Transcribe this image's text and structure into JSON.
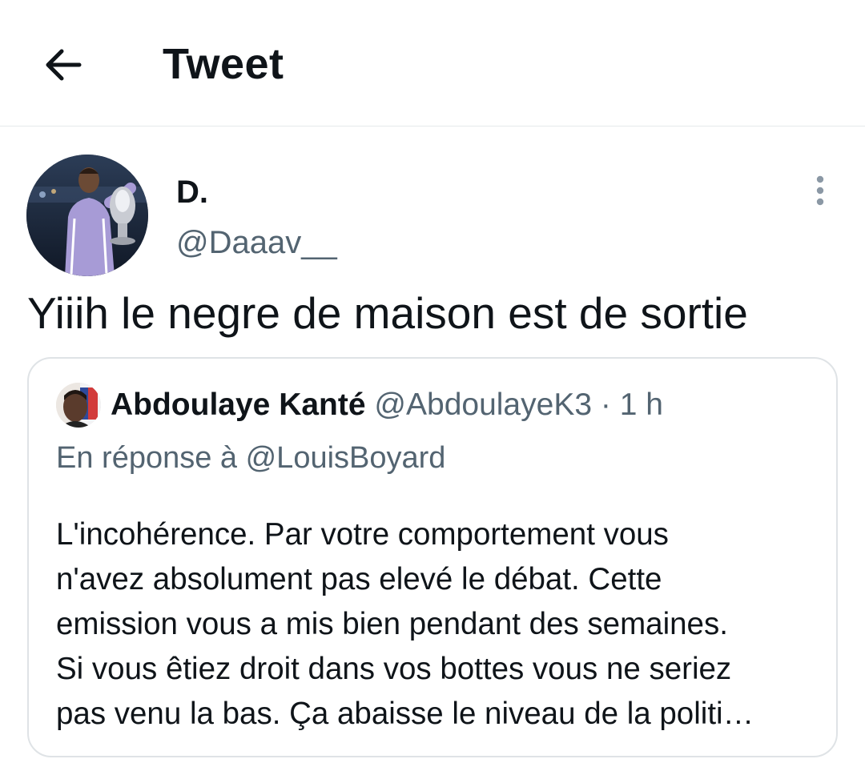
{
  "header": {
    "title": "Tweet",
    "back_icon": "arrow-left-icon"
  },
  "tweet": {
    "author": {
      "display_name": "D.",
      "handle": "@Daaav__"
    },
    "text": "Yiiih le negre de maison est de sortie",
    "more_icon": "vertical-ellipsis-icon"
  },
  "quoted_tweet": {
    "author": {
      "display_name": "Abdoulaye Kanté",
      "handle": "@AbdoulayeK3"
    },
    "separator": "·",
    "time": "1 h",
    "reply_context": "En réponse à @LouisBoyard",
    "lines": [
      "L'incohérence. Par votre comportement vous",
      "n'avez absolument pas elevé le débat. Cette",
      "emission vous a mis bien pendant des semaines.",
      "Si vous êtiez droit dans vos bottes vous ne seriez",
      "pas venu la bas. Ça abaisse le niveau de la politi…"
    ]
  },
  "colors": {
    "text_primary": "#0f1419",
    "text_secondary": "#536471",
    "border": "#dfe3e6"
  }
}
